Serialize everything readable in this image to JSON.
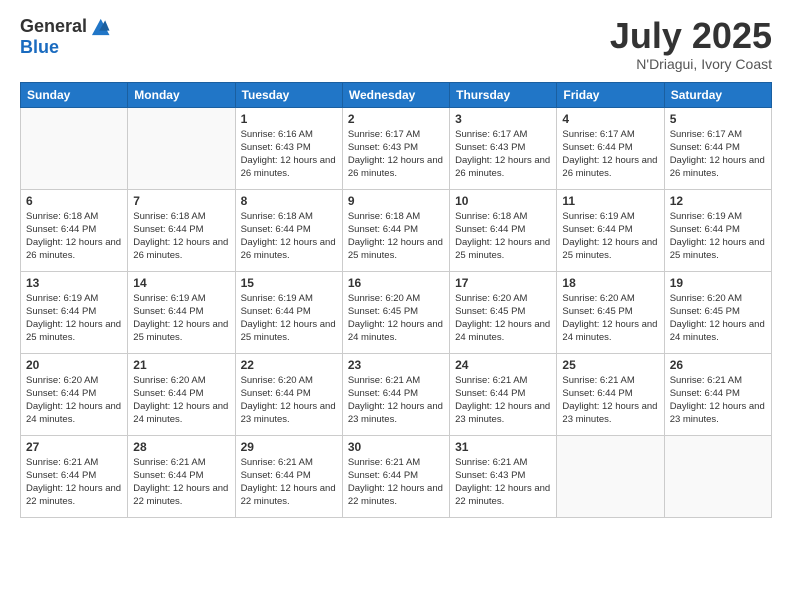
{
  "header": {
    "logo_general": "General",
    "logo_blue": "Blue",
    "month": "July 2025",
    "location": "N'Driagui, Ivory Coast"
  },
  "weekdays": [
    "Sunday",
    "Monday",
    "Tuesday",
    "Wednesday",
    "Thursday",
    "Friday",
    "Saturday"
  ],
  "weeks": [
    [
      {
        "day": "",
        "info": ""
      },
      {
        "day": "",
        "info": ""
      },
      {
        "day": "1",
        "info": "Sunrise: 6:16 AM\nSunset: 6:43 PM\nDaylight: 12 hours and 26 minutes."
      },
      {
        "day": "2",
        "info": "Sunrise: 6:17 AM\nSunset: 6:43 PM\nDaylight: 12 hours and 26 minutes."
      },
      {
        "day": "3",
        "info": "Sunrise: 6:17 AM\nSunset: 6:43 PM\nDaylight: 12 hours and 26 minutes."
      },
      {
        "day": "4",
        "info": "Sunrise: 6:17 AM\nSunset: 6:44 PM\nDaylight: 12 hours and 26 minutes."
      },
      {
        "day": "5",
        "info": "Sunrise: 6:17 AM\nSunset: 6:44 PM\nDaylight: 12 hours and 26 minutes."
      }
    ],
    [
      {
        "day": "6",
        "info": "Sunrise: 6:18 AM\nSunset: 6:44 PM\nDaylight: 12 hours and 26 minutes."
      },
      {
        "day": "7",
        "info": "Sunrise: 6:18 AM\nSunset: 6:44 PM\nDaylight: 12 hours and 26 minutes."
      },
      {
        "day": "8",
        "info": "Sunrise: 6:18 AM\nSunset: 6:44 PM\nDaylight: 12 hours and 26 minutes."
      },
      {
        "day": "9",
        "info": "Sunrise: 6:18 AM\nSunset: 6:44 PM\nDaylight: 12 hours and 25 minutes."
      },
      {
        "day": "10",
        "info": "Sunrise: 6:18 AM\nSunset: 6:44 PM\nDaylight: 12 hours and 25 minutes."
      },
      {
        "day": "11",
        "info": "Sunrise: 6:19 AM\nSunset: 6:44 PM\nDaylight: 12 hours and 25 minutes."
      },
      {
        "day": "12",
        "info": "Sunrise: 6:19 AM\nSunset: 6:44 PM\nDaylight: 12 hours and 25 minutes."
      }
    ],
    [
      {
        "day": "13",
        "info": "Sunrise: 6:19 AM\nSunset: 6:44 PM\nDaylight: 12 hours and 25 minutes."
      },
      {
        "day": "14",
        "info": "Sunrise: 6:19 AM\nSunset: 6:44 PM\nDaylight: 12 hours and 25 minutes."
      },
      {
        "day": "15",
        "info": "Sunrise: 6:19 AM\nSunset: 6:44 PM\nDaylight: 12 hours and 25 minutes."
      },
      {
        "day": "16",
        "info": "Sunrise: 6:20 AM\nSunset: 6:45 PM\nDaylight: 12 hours and 24 minutes."
      },
      {
        "day": "17",
        "info": "Sunrise: 6:20 AM\nSunset: 6:45 PM\nDaylight: 12 hours and 24 minutes."
      },
      {
        "day": "18",
        "info": "Sunrise: 6:20 AM\nSunset: 6:45 PM\nDaylight: 12 hours and 24 minutes."
      },
      {
        "day": "19",
        "info": "Sunrise: 6:20 AM\nSunset: 6:45 PM\nDaylight: 12 hours and 24 minutes."
      }
    ],
    [
      {
        "day": "20",
        "info": "Sunrise: 6:20 AM\nSunset: 6:44 PM\nDaylight: 12 hours and 24 minutes."
      },
      {
        "day": "21",
        "info": "Sunrise: 6:20 AM\nSunset: 6:44 PM\nDaylight: 12 hours and 24 minutes."
      },
      {
        "day": "22",
        "info": "Sunrise: 6:20 AM\nSunset: 6:44 PM\nDaylight: 12 hours and 23 minutes."
      },
      {
        "day": "23",
        "info": "Sunrise: 6:21 AM\nSunset: 6:44 PM\nDaylight: 12 hours and 23 minutes."
      },
      {
        "day": "24",
        "info": "Sunrise: 6:21 AM\nSunset: 6:44 PM\nDaylight: 12 hours and 23 minutes."
      },
      {
        "day": "25",
        "info": "Sunrise: 6:21 AM\nSunset: 6:44 PM\nDaylight: 12 hours and 23 minutes."
      },
      {
        "day": "26",
        "info": "Sunrise: 6:21 AM\nSunset: 6:44 PM\nDaylight: 12 hours and 23 minutes."
      }
    ],
    [
      {
        "day": "27",
        "info": "Sunrise: 6:21 AM\nSunset: 6:44 PM\nDaylight: 12 hours and 22 minutes."
      },
      {
        "day": "28",
        "info": "Sunrise: 6:21 AM\nSunset: 6:44 PM\nDaylight: 12 hours and 22 minutes."
      },
      {
        "day": "29",
        "info": "Sunrise: 6:21 AM\nSunset: 6:44 PM\nDaylight: 12 hours and 22 minutes."
      },
      {
        "day": "30",
        "info": "Sunrise: 6:21 AM\nSunset: 6:44 PM\nDaylight: 12 hours and 22 minutes."
      },
      {
        "day": "31",
        "info": "Sunrise: 6:21 AM\nSunset: 6:43 PM\nDaylight: 12 hours and 22 minutes."
      },
      {
        "day": "",
        "info": ""
      },
      {
        "day": "",
        "info": ""
      }
    ]
  ]
}
